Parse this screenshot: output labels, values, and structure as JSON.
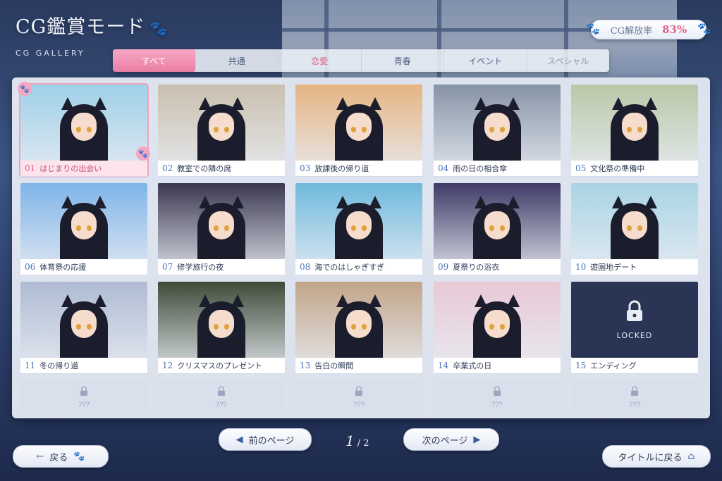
{
  "header": {
    "title": "CG鑑賞モード",
    "subtitle": "CG GALLERY",
    "unlock_label": "CG解放率",
    "unlock_value": "83%"
  },
  "tabs": [
    "すべて",
    "共通",
    "恋愛",
    "青春",
    "イベント",
    "スペシャル"
  ],
  "active_tab": 0,
  "cards": [
    {
      "num": "01",
      "title": "はじまりの出会い",
      "bg": "#9fd0e8"
    },
    {
      "num": "02",
      "title": "教室での隣の席",
      "bg": "#c9bfae"
    },
    {
      "num": "03",
      "title": "放課後の帰り道",
      "bg": "#e6b483"
    },
    {
      "num": "04",
      "title": "雨の日の相合傘",
      "bg": "#8693a6"
    },
    {
      "num": "05",
      "title": "文化祭の準備中",
      "bg": "#b9c8a8"
    },
    {
      "num": "06",
      "title": "体育祭の応援",
      "bg": "#7fb4e8"
    },
    {
      "num": "07",
      "title": "修学旅行の夜",
      "bg": "#3b3850"
    },
    {
      "num": "08",
      "title": "海でのはしゃぎすぎ",
      "bg": "#6fb9dc"
    },
    {
      "num": "09",
      "title": "夏祭りの浴衣",
      "bg": "#3f3a66"
    },
    {
      "num": "10",
      "title": "遊園地デート",
      "bg": "#a9d4e4"
    },
    {
      "num": "11",
      "title": "冬の帰り道",
      "bg": "#aebbd2"
    },
    {
      "num": "12",
      "title": "クリスマスのプレゼント",
      "bg": "#3e4b39"
    },
    {
      "num": "13",
      "title": "告白の瞬間",
      "bg": "#c2a589"
    },
    {
      "num": "14",
      "title": "卒業式の日",
      "bg": "#e8c9d6"
    },
    {
      "num": "15",
      "title": "エンディング",
      "locked": true,
      "locked_text": "LOCKED"
    }
  ],
  "empty_slot_text": "???",
  "pagination": {
    "prev_label": "前のページ",
    "next_label": "次のページ",
    "current": "1",
    "total": "/ 2"
  },
  "footer": {
    "back_label": "戻る",
    "title_label": "タイトルに戻る"
  },
  "colors": {
    "accent_pink": "#ea7fa5",
    "lock_bg": "#2a3556"
  }
}
